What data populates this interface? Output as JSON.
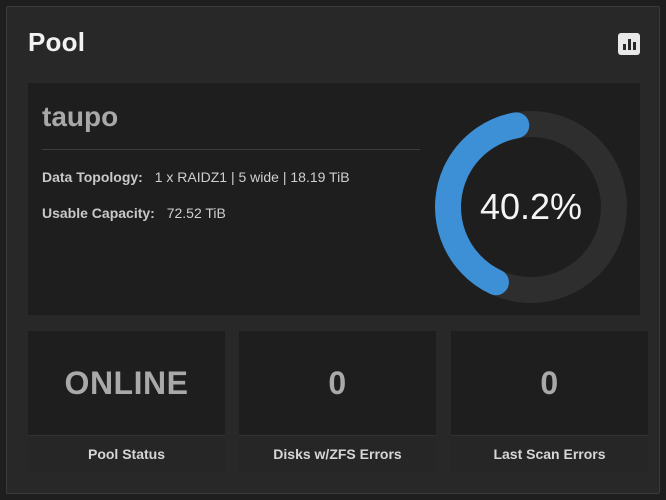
{
  "widget": {
    "title": "Pool",
    "chart_icon": "bar-chart-icon"
  },
  "pool": {
    "name": "taupo",
    "data_topology_label": "Data Topology:",
    "data_topology_value": "1 x RAIDZ1 | 5 wide | 18.19 TiB",
    "usable_capacity_label": "Usable Capacity:",
    "usable_capacity_value": "72.52 TiB"
  },
  "usage": {
    "percent_text": "40.2%",
    "percent": 40.2
  },
  "tiles": [
    {
      "value": "ONLINE",
      "label": "Pool Status"
    },
    {
      "value": "0",
      "label": "Disks w/ZFS Errors"
    },
    {
      "value": "0",
      "label": "Last Scan Errors"
    }
  ],
  "colors": {
    "gauge_fill": "#3d8fd6",
    "gauge_track": "#2e2e2e"
  }
}
